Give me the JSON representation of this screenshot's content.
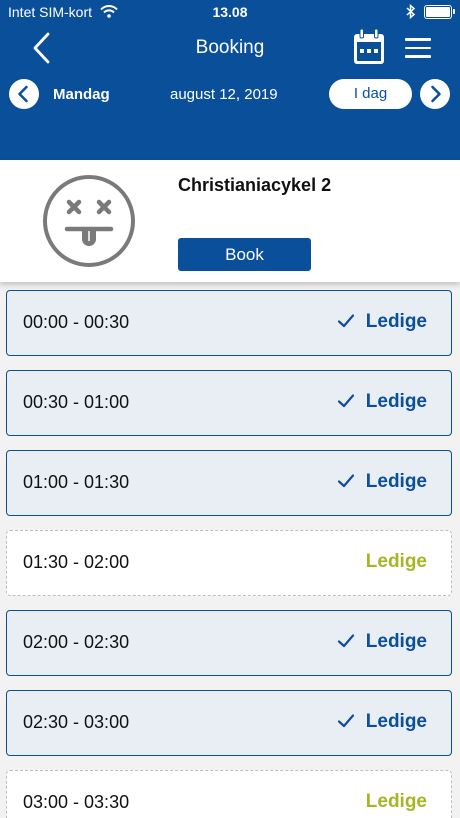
{
  "status_bar": {
    "carrier": "Intet SIM-kort",
    "time": "13.08"
  },
  "nav": {
    "title": "Booking",
    "back_icon": "chevron-left-icon",
    "calendar_icon": "calendar-icon",
    "menu_icon": "hamburger-menu-icon"
  },
  "date_bar": {
    "day": "Mandag",
    "date": "august 12, 2019",
    "today_label": "I dag"
  },
  "item": {
    "title": "Christianiacykel 2",
    "book_label": "Book",
    "avatar_icon": "dizzy-face-icon"
  },
  "colors": {
    "primary": "#0a4f9a",
    "available_text": "#0a4f9a",
    "open_text": "#a8b424",
    "slot_bg": "#e9eef4"
  },
  "slots": [
    {
      "time": "00:00 - 00:30",
      "status": "Ledige",
      "checked": true
    },
    {
      "time": "00:30 - 01:00",
      "status": "Ledige",
      "checked": true
    },
    {
      "time": "01:00 - 01:30",
      "status": "Ledige",
      "checked": true
    },
    {
      "time": "01:30 - 02:00",
      "status": "Ledige",
      "checked": false
    },
    {
      "time": "02:00 - 02:30",
      "status": "Ledige",
      "checked": true
    },
    {
      "time": "02:30 - 03:00",
      "status": "Ledige",
      "checked": true
    },
    {
      "time": "03:00 - 03:30",
      "status": "Ledige",
      "checked": false
    }
  ]
}
